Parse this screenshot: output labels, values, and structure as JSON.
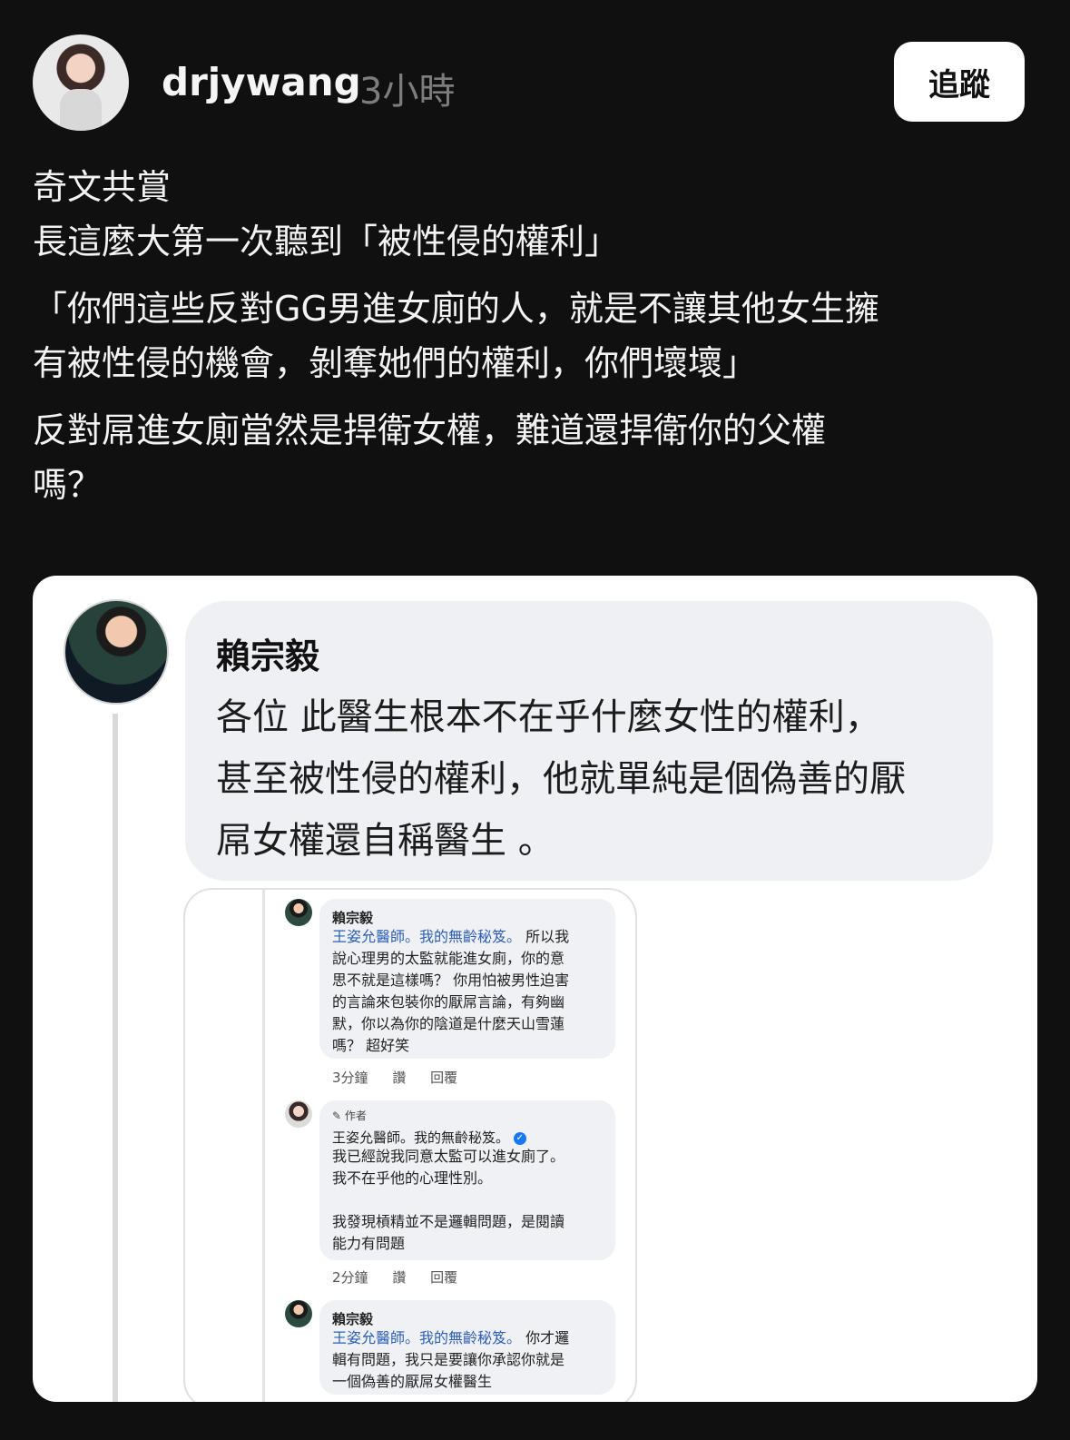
{
  "post": {
    "username": "drjywang",
    "time": "3小時",
    "follow_label": "追蹤",
    "lines": [
      "奇文共賞",
      "長這麼大第一次聽到「被性侵的權利」",
      "「你們這些反對GG男進女廁的人，就是不讓其他女生擁",
      "有被性侵的機會，剝奪她們的權利，你們壞壞」",
      "反對屌進女廁當然是捍衛女權，難道還捍衛你的父權",
      "嗎？"
    ]
  },
  "quoted": {
    "name": "賴宗毅",
    "lines": [
      "各位 此醫生根本不在乎什麼女性的權利，",
      "甚至被性侵的權利，他就單純是個偽善的厭",
      "屌女權還自稱醫生 。"
    ],
    "comments": [
      {
        "name": "賴宗毅",
        "mention": "王姿允醫師。我的無齡秘笈。",
        "text_first": " 所以我",
        "lines": [
          "說心理男的太監就能進女廁，你的意",
          "思不就是這樣嗎？ 你用怕被男性迫害",
          "的言論來包裝你的厭屌言論，有夠幽",
          "默，你以為你的陰道是什麼天山雪蓮",
          "嗎？ 超好笑"
        ],
        "meta": [
          "3分鐘",
          "讚",
          "回覆"
        ]
      },
      {
        "author_tag": "✎ 作者",
        "name": "王姿允醫師。我的無齡秘笈。",
        "lines": [
          "我已經說我同意太監可以進女廁了。",
          "我不在乎他的心理性別。",
          "",
          "我發現槓精並不是邏輯問題，是閱讀",
          "能力有問題"
        ],
        "meta": [
          "2分鐘",
          "讚",
          "回覆"
        ]
      },
      {
        "name": "賴宗毅",
        "mention": "王姿允醫師。我的無齡秘笈。",
        "text_first": " 你才邏",
        "lines": [
          "輯有問題，我只是要讓你承認你就是",
          "一個偽善的厭屌女權醫生"
        ]
      }
    ]
  }
}
